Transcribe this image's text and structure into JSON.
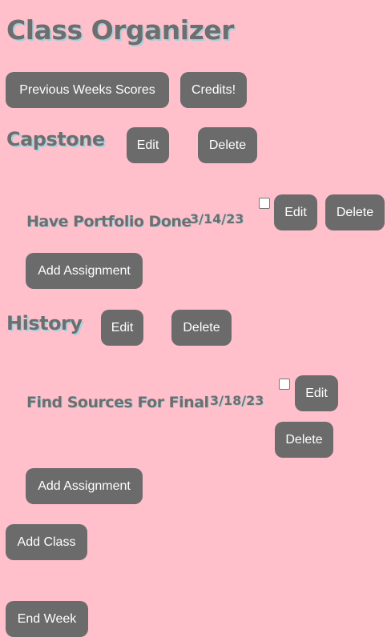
{
  "app": {
    "title": "Class Organizer"
  },
  "toolbar": {
    "previous_scores_label": "Previous Weeks Scores",
    "credits_label": "Credits!"
  },
  "classes": [
    {
      "name": "Capstone",
      "edit_label": "Edit",
      "delete_label": "Delete",
      "assignments": [
        {
          "name": "Have Portfolio Done",
          "date": "3/14/23",
          "completed": false,
          "edit_label": "Edit",
          "delete_label": "Delete"
        }
      ],
      "add_assignment_label": "Add Assignment"
    },
    {
      "name": "History",
      "edit_label": "Edit",
      "delete_label": "Delete",
      "assignments": [
        {
          "name": "Find Sources For Final",
          "date": "3/18/23",
          "completed": false,
          "edit_label": "Edit",
          "delete_label": "Delete"
        }
      ],
      "add_assignment_label": "Add Assignment"
    }
  ],
  "footer": {
    "add_class_label": "Add Class",
    "end_week_label": "End Week"
  }
}
